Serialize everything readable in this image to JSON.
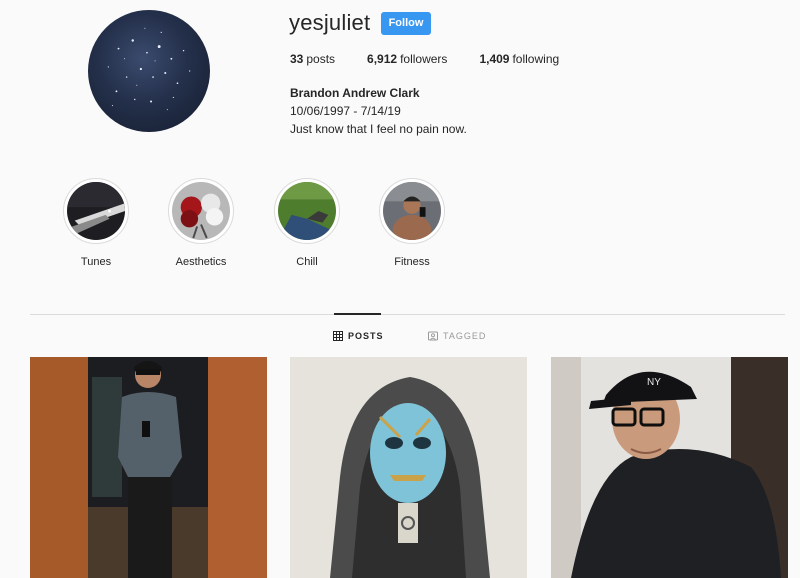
{
  "profile": {
    "username": "yesjuliet",
    "follow_label": "Follow",
    "stats": [
      {
        "count": "33",
        "label": "posts"
      },
      {
        "count": "6,912",
        "label": "followers"
      },
      {
        "count": "1,409",
        "label": "following"
      }
    ],
    "full_name": "Brandon Andrew Clark",
    "bio_line1": "10/06/1997 - 7/14/19",
    "bio_line2": "Just know that I feel no pain now."
  },
  "highlights": [
    {
      "label": "Tunes"
    },
    {
      "label": "Aesthetics"
    },
    {
      "label": "Chill"
    },
    {
      "label": "Fitness"
    }
  ],
  "tabs": {
    "posts_label": "POSTS",
    "tagged_label": "TAGGED"
  },
  "colors": {
    "accent": "#3897f0",
    "text": "#262626",
    "background": "#fafafa",
    "border": "#dbdbdb"
  }
}
